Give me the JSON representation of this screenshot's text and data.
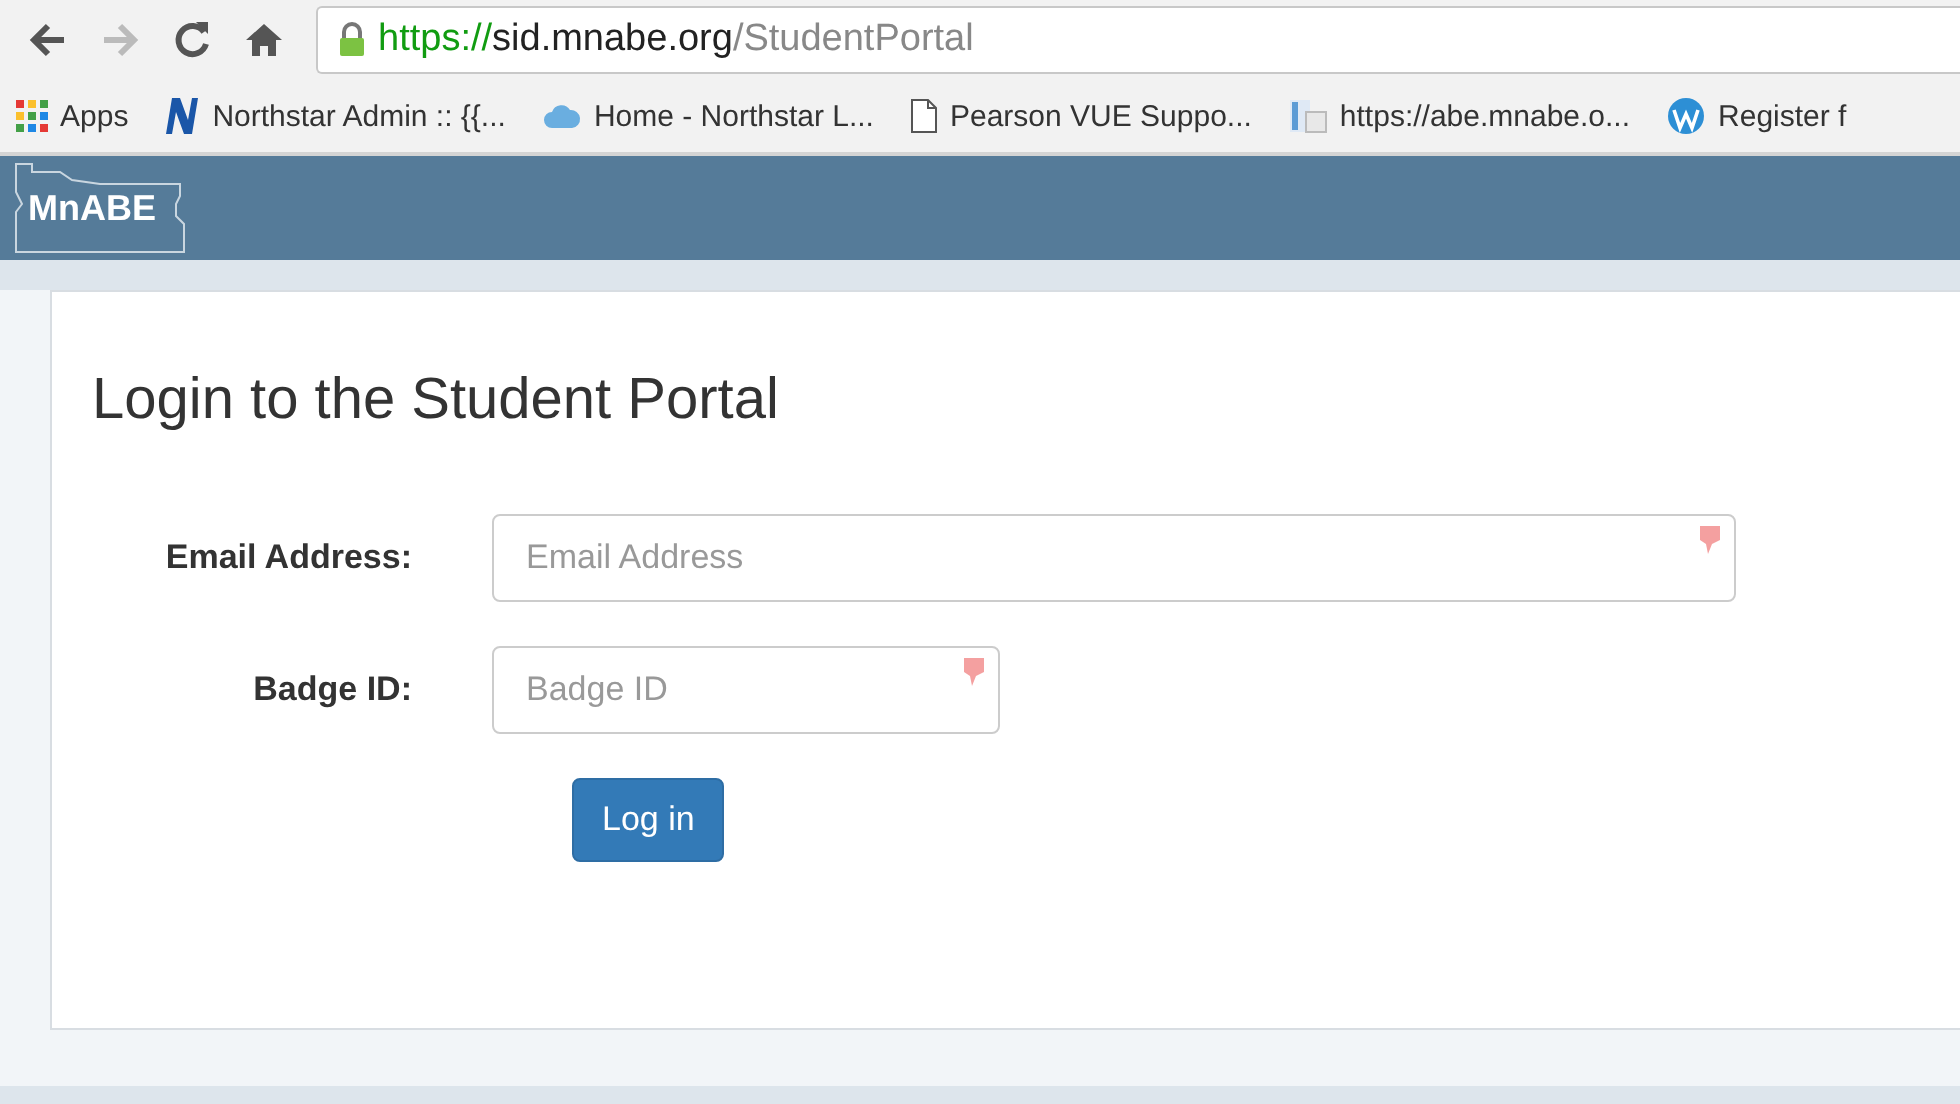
{
  "browser": {
    "url": {
      "scheme": "https://",
      "host": "sid.mnabe.org",
      "path": "/StudentPortal"
    },
    "bookmarks": [
      {
        "kind": "apps",
        "label": "Apps"
      },
      {
        "kind": "n-logo",
        "label": "Northstar Admin :: {{..."
      },
      {
        "kind": "cloud",
        "label": "Home - Northstar L..."
      },
      {
        "kind": "page",
        "label": "Pearson VUE Suppo..."
      },
      {
        "kind": "doc",
        "label": "https://abe.mnabe.o..."
      },
      {
        "kind": "wordpress",
        "label": "Register f"
      }
    ]
  },
  "header": {
    "logo": "MnABE"
  },
  "form": {
    "title": "Login to the Student Portal",
    "fields": [
      {
        "label": "Email Address:",
        "placeholder": "Email Address",
        "wide": true
      },
      {
        "label": "Badge ID:",
        "placeholder": "Badge ID",
        "wide": false
      }
    ],
    "submit": "Log in"
  }
}
